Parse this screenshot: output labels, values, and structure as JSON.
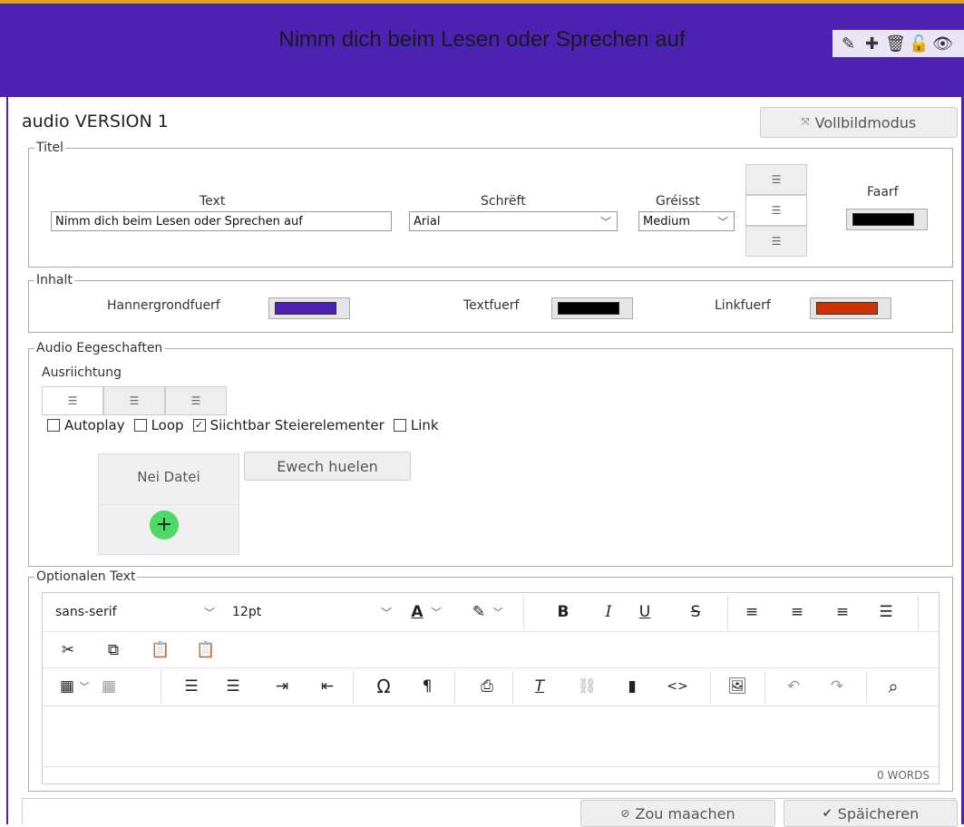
{
  "header": {
    "title": "Nimm dich beim Lesen oder Sprechen auf",
    "icons": [
      "pencil-icon",
      "plus-icon",
      "trash-icon",
      "unlock-icon",
      "eye-icon"
    ]
  },
  "panel": {
    "title": "audio VERSION 1",
    "fullscreen_label": "Vollbildmodus"
  },
  "titel": {
    "legend": "Titel",
    "text_label": "Text",
    "text_value": "Nimm dich beim Lesen oder Sprechen auf",
    "font_label": "Schrëft",
    "font_value": "Arial",
    "size_label": "Gréisst",
    "size_value": "Medium",
    "color_label": "Faarf",
    "color": "#000000"
  },
  "inhalt": {
    "legend": "Inhalt",
    "bg_label": "Hannergrondfuerf",
    "bg_color": "#4d22b2",
    "text_label": "Textfuerf",
    "text_color": "#000000",
    "link_label": "Linkfuerf",
    "link_color": "#cc3300"
  },
  "audio": {
    "legend": "Audio Eegeschaften",
    "alignment_label": "Ausriichtung",
    "checkboxes": [
      {
        "label": "Autoplay",
        "checked": false
      },
      {
        "label": "Loop",
        "checked": false
      },
      {
        "label": "Siichtbar Steierelementer",
        "checked": true
      },
      {
        "label": "Link",
        "checked": false
      }
    ],
    "new_file_label": "Nei Datei",
    "choose_label": "Ewech huelen"
  },
  "optional": {
    "legend": "Optionalen Text",
    "font": "sans-serif",
    "size": "12pt",
    "word_count": "0 WORDS"
  },
  "footer": {
    "cancel_label": "Zou maachen",
    "save_label": "Späicheren"
  },
  "colors": {
    "brand": "#4d22b2",
    "accent_top": "#d9a418",
    "add_green": "#4cd964"
  }
}
